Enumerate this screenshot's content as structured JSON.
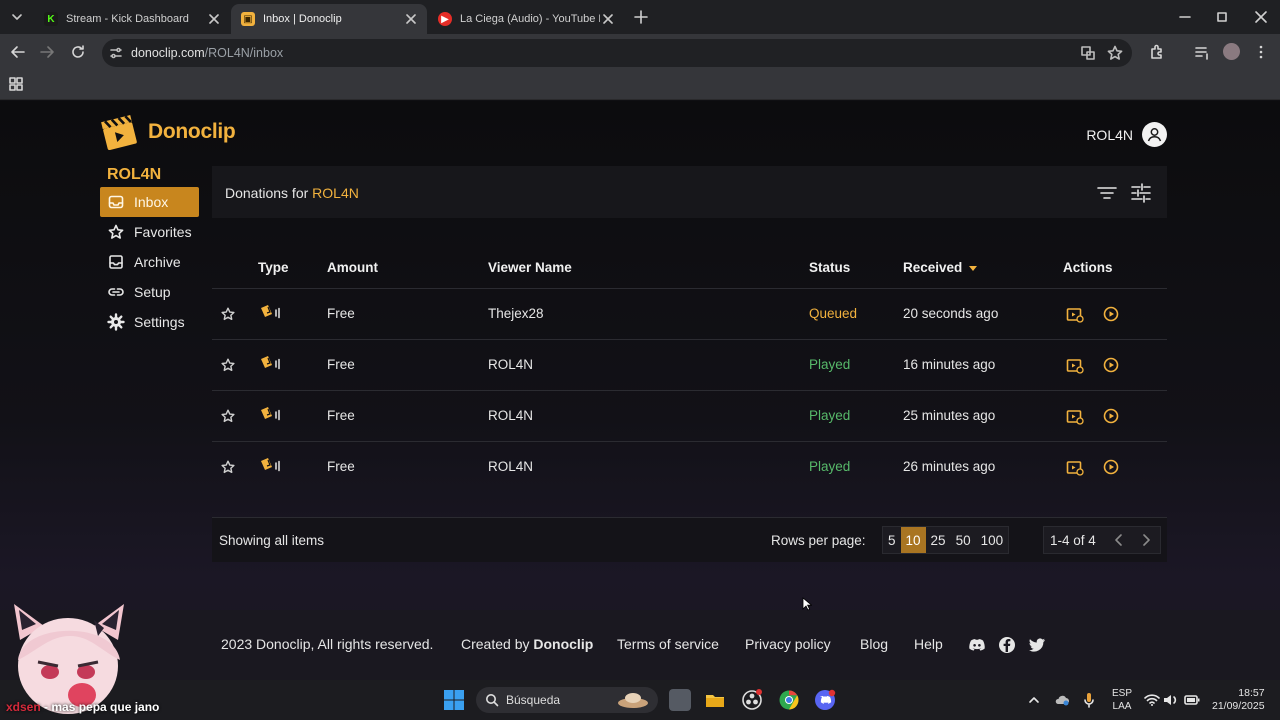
{
  "browser": {
    "tabs": [
      {
        "title": "Stream - Kick Dashboard",
        "active": false,
        "favicon": "kick-icon"
      },
      {
        "title": "Inbox | Donoclip",
        "active": true,
        "favicon": "donoclip-icon"
      },
      {
        "title": "La Ciega (Audio) - YouTube Mu",
        "active": false,
        "favicon": "youtube-music-icon"
      }
    ],
    "url_host": "donoclip.com",
    "url_path": "/ROL4N/inbox"
  },
  "site": {
    "brand": "Donoclip",
    "accent": "#f2b23e",
    "header_username": "ROL4N",
    "sidebar_username": "ROL4N",
    "nav": [
      {
        "label": "Inbox",
        "icon": "inbox-icon",
        "active": true
      },
      {
        "label": "Favorites",
        "icon": "star-icon",
        "active": false
      },
      {
        "label": "Archive",
        "icon": "archive-icon",
        "active": false
      },
      {
        "label": "Setup",
        "icon": "link-icon",
        "active": false
      },
      {
        "label": "Settings",
        "icon": "gear-icon",
        "active": false
      }
    ]
  },
  "inbox": {
    "title_prefix": "Donations for",
    "title_user": "ROL4N",
    "columns": [
      "Type",
      "Amount",
      "Viewer Name",
      "Status",
      "Received",
      "Actions"
    ],
    "rows": [
      {
        "amount": "Free",
        "viewer": "Thejex28",
        "status": "Queued",
        "received": "20 seconds ago"
      },
      {
        "amount": "Free",
        "viewer": "ROL4N",
        "status": "Played",
        "received": "16 minutes ago"
      },
      {
        "amount": "Free",
        "viewer": "ROL4N",
        "status": "Played",
        "received": "25 minutes ago"
      },
      {
        "amount": "Free",
        "viewer": "ROL4N",
        "status": "Played",
        "received": "26 minutes ago"
      }
    ],
    "showing": "Showing all items",
    "rows_per_page_label": "Rows per page:",
    "rows_per_page_options": [
      "5",
      "10",
      "25",
      "50",
      "100"
    ],
    "rows_per_page_selected": "10",
    "range": "1-4 of 4"
  },
  "footer": {
    "copyright": "2023 Donoclip, All rights reserved.",
    "created_by_prefix": "Created by",
    "created_by_name": "Donoclip",
    "links": [
      "Terms of service",
      "Privacy policy",
      "Blog",
      "Help"
    ]
  },
  "taskbar": {
    "search_placeholder": "Búsqueda",
    "lang_1": "ESP",
    "lang_2": "LAA",
    "time": "18:57",
    "date": "21/09/2025"
  },
  "overlay": {
    "name": "xdsen",
    "message": "mas pepa que jano"
  }
}
